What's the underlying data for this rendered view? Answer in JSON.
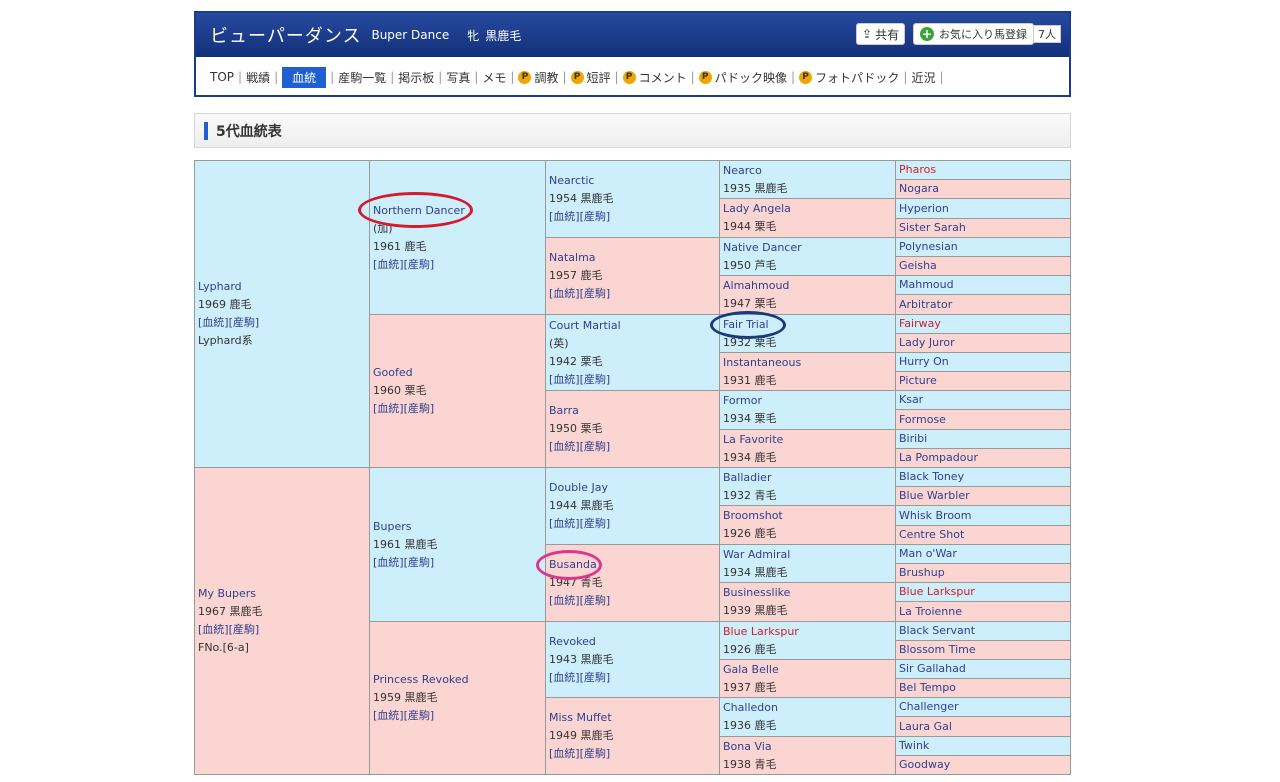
{
  "header": {
    "horse_name": "ビューパーダンス",
    "horse_name_en": "Buper Dance",
    "sex": "牝",
    "color": "黒鹿毛",
    "share_label": "共有",
    "fav_label": "お気に入り馬登録",
    "fav_count": "7人"
  },
  "nav": [
    {
      "label": "TOP",
      "p": false,
      "active": false
    },
    {
      "label": "戦績",
      "p": false,
      "active": false
    },
    {
      "label": "血統",
      "p": false,
      "active": true
    },
    {
      "label": "産駒一覧",
      "p": false,
      "active": false
    },
    {
      "label": "掲示板",
      "p": false,
      "active": false
    },
    {
      "label": "写真",
      "p": false,
      "active": false
    },
    {
      "label": "メモ",
      "p": false,
      "active": false
    },
    {
      "label": "調教",
      "p": true,
      "active": false
    },
    {
      "label": "短評",
      "p": true,
      "active": false
    },
    {
      "label": "コメント",
      "p": true,
      "active": false
    },
    {
      "label": "パドック映像",
      "p": true,
      "active": false
    },
    {
      "label": "フォトパドック",
      "p": true,
      "active": false
    },
    {
      "label": "近況",
      "p": false,
      "active": false
    }
  ],
  "p_mark": "P",
  "section": {
    "title": "5代血統表"
  },
  "pedigree": {
    "gen1": [
      {
        "name": "Lyphard",
        "lines": [
          "1969 鹿毛",
          "[血統][産駒]",
          "Lyphard系"
        ],
        "color": "blue"
      },
      {
        "name": "My Bupers",
        "lines": [
          "1967 黒鹿毛",
          "[血統][産駒]",
          "FNo.[6-a]"
        ],
        "color": "pink"
      }
    ],
    "gen2": [
      {
        "name": "Northern Dancer",
        "lines": [
          "(加)",
          "1961 鹿毛",
          "[血統][産駒]"
        ],
        "color": "blue"
      },
      {
        "name": "Goofed",
        "lines": [
          "1960 栗毛",
          "[血統][産駒]"
        ],
        "color": "pink"
      },
      {
        "name": "Bupers",
        "lines": [
          "1961 黒鹿毛",
          "[血統][産駒]"
        ],
        "color": "blue"
      },
      {
        "name": "Princess Revoked",
        "lines": [
          "1959 黒鹿毛",
          "[血統][産駒]"
        ],
        "color": "pink"
      }
    ],
    "gen3": [
      {
        "name": "Nearctic",
        "lines": [
          "1954 黒鹿毛",
          "[血統][産駒]"
        ],
        "color": "blue"
      },
      {
        "name": "Natalma",
        "lines": [
          "1957 鹿毛",
          "[血統][産駒]"
        ],
        "color": "pink"
      },
      {
        "name": "Court Martial",
        "lines": [
          "(英)",
          "1942 栗毛",
          "[血統][産駒]"
        ],
        "color": "blue"
      },
      {
        "name": "Barra",
        "lines": [
          "1950 栗毛",
          "[血統][産駒]"
        ],
        "color": "pink"
      },
      {
        "name": "Double Jay",
        "lines": [
          "1944 黒鹿毛",
          "[血統][産駒]"
        ],
        "color": "blue"
      },
      {
        "name": "Busanda",
        "lines": [
          "1947 青毛",
          "[血統][産駒]"
        ],
        "color": "pink"
      },
      {
        "name": "Revoked",
        "lines": [
          "1943 黒鹿毛",
          "[血統][産駒]"
        ],
        "color": "blue"
      },
      {
        "name": "Miss Muffet",
        "lines": [
          "1949 黒鹿毛",
          "[血統][産駒]"
        ],
        "color": "pink"
      }
    ],
    "gen4": [
      {
        "name": "Nearco",
        "lines": [
          "1935 黒鹿毛"
        ],
        "color": "blue",
        "red": false
      },
      {
        "name": "Lady Angela",
        "lines": [
          "1944 栗毛"
        ],
        "color": "pink",
        "red": false
      },
      {
        "name": "Native Dancer",
        "lines": [
          "1950 芦毛"
        ],
        "color": "blue",
        "red": false
      },
      {
        "name": "Almahmoud",
        "lines": [
          "1947 栗毛"
        ],
        "color": "pink",
        "red": false
      },
      {
        "name": "Fair Trial",
        "lines": [
          "1932 栗毛"
        ],
        "color": "blue",
        "red": false
      },
      {
        "name": "Instantaneous",
        "lines": [
          "1931 鹿毛"
        ],
        "color": "pink",
        "red": false
      },
      {
        "name": "Formor",
        "lines": [
          "1934 栗毛"
        ],
        "color": "blue",
        "red": false
      },
      {
        "name": "La Favorite",
        "lines": [
          "1934 鹿毛"
        ],
        "color": "pink",
        "red": false
      },
      {
        "name": "Balladier",
        "lines": [
          "1932 青毛"
        ],
        "color": "blue",
        "red": false
      },
      {
        "name": "Broomshot",
        "lines": [
          "1926 鹿毛"
        ],
        "color": "pink",
        "red": false
      },
      {
        "name": "War Admiral",
        "lines": [
          "1934 黒鹿毛"
        ],
        "color": "blue",
        "red": false
      },
      {
        "name": "Businesslike",
        "lines": [
          "1939 黒鹿毛"
        ],
        "color": "pink",
        "red": false
      },
      {
        "name": "Blue Larkspur",
        "lines": [
          "1926 鹿毛"
        ],
        "color": "blue",
        "red": true
      },
      {
        "name": "Gala Belle",
        "lines": [
          "1937 鹿毛"
        ],
        "color": "pink",
        "red": false
      },
      {
        "name": "Challedon",
        "lines": [
          "1936 鹿毛"
        ],
        "color": "blue",
        "red": false
      },
      {
        "name": "Bona Via",
        "lines": [
          "1938 青毛"
        ],
        "color": "pink",
        "red": false
      }
    ],
    "gen5": [
      {
        "name": "Pharos",
        "color": "blue",
        "red": true
      },
      {
        "name": "Nogara",
        "color": "pink",
        "red": false
      },
      {
        "name": "Hyperion",
        "color": "blue",
        "red": false
      },
      {
        "name": "Sister Sarah",
        "color": "pink",
        "red": false
      },
      {
        "name": "Polynesian",
        "color": "blue",
        "red": false
      },
      {
        "name": "Geisha",
        "color": "pink",
        "red": false
      },
      {
        "name": "Mahmoud",
        "color": "blue",
        "red": false
      },
      {
        "name": "Arbitrator",
        "color": "pink",
        "red": false
      },
      {
        "name": "Fairway",
        "color": "blue",
        "red": true
      },
      {
        "name": "Lady Juror",
        "color": "pink",
        "red": false
      },
      {
        "name": "Hurry On",
        "color": "blue",
        "red": false
      },
      {
        "name": "Picture",
        "color": "pink",
        "red": false
      },
      {
        "name": "Ksar",
        "color": "blue",
        "red": false
      },
      {
        "name": "Formose",
        "color": "pink",
        "red": false
      },
      {
        "name": "Biribi",
        "color": "blue",
        "red": false
      },
      {
        "name": "La Pompadour",
        "color": "pink",
        "red": false
      },
      {
        "name": "Black Toney",
        "color": "blue",
        "red": false
      },
      {
        "name": "Blue Warbler",
        "color": "pink",
        "red": false
      },
      {
        "name": "Whisk Broom",
        "color": "blue",
        "red": false
      },
      {
        "name": "Centre Shot",
        "color": "pink",
        "red": false
      },
      {
        "name": "Man o'War",
        "color": "blue",
        "red": false
      },
      {
        "name": "Brushup",
        "color": "pink",
        "red": false
      },
      {
        "name": "Blue Larkspur",
        "color": "blue",
        "red": true
      },
      {
        "name": "La Troienne",
        "color": "pink",
        "red": false
      },
      {
        "name": "Black Servant",
        "color": "blue",
        "red": false
      },
      {
        "name": "Blossom Time",
        "color": "pink",
        "red": false
      },
      {
        "name": "Sir Gallahad",
        "color": "blue",
        "red": false
      },
      {
        "name": "Bel Tempo",
        "color": "pink",
        "red": false
      },
      {
        "name": "Challenger",
        "color": "blue",
        "red": false
      },
      {
        "name": "Laura Gal",
        "color": "pink",
        "red": false
      },
      {
        "name": "Twink",
        "color": "blue",
        "red": false
      },
      {
        "name": "Goodway",
        "color": "pink",
        "red": false
      }
    ]
  },
  "colors": {
    "header_blue": "#1b3b8c",
    "nav_active": "#1f5fd0",
    "sire_bg": "#cdeefb",
    "dam_bg": "#fbd5d1",
    "link": "#2f3f90",
    "highlight_red": "#d0202a"
  }
}
